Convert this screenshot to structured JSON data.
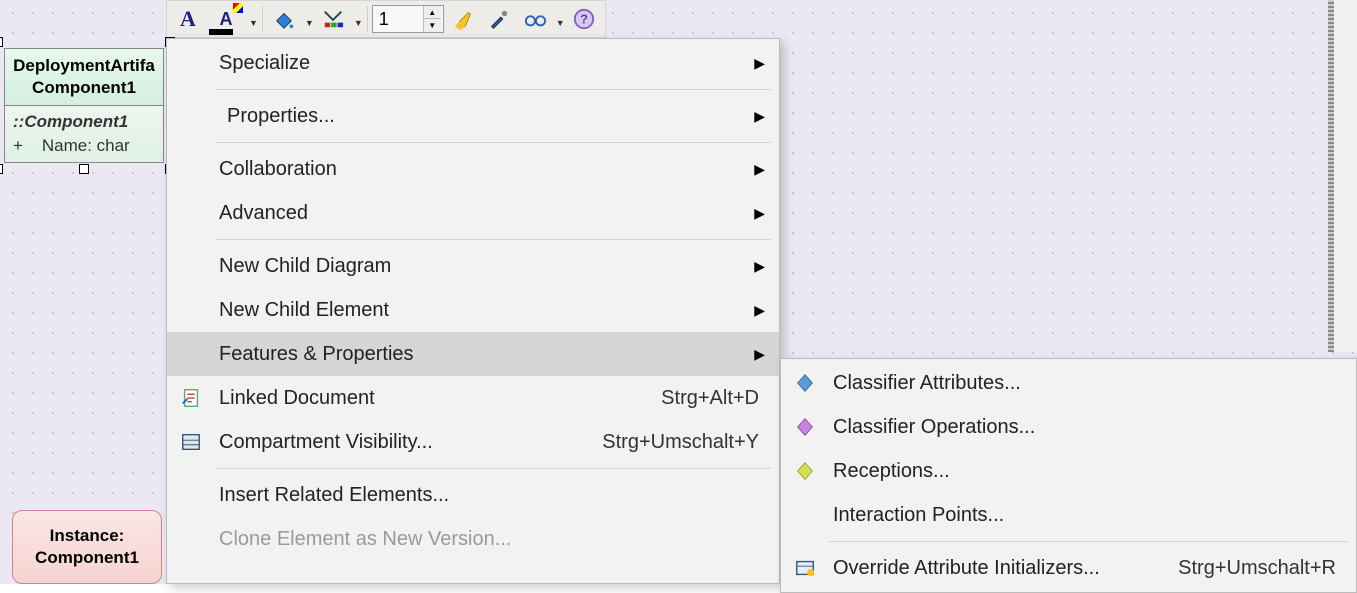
{
  "toolbar": {
    "spin_value": "1"
  },
  "component": {
    "title_line1": "DeploymentArtifa",
    "title_line2": "Component1",
    "section_name": "::Component1",
    "attr_prefix": "+",
    "attr_text": "Name: char"
  },
  "instance": {
    "line1": "Instance:",
    "line2": "Component1"
  },
  "menu": {
    "specialize": "Specialize",
    "properties": "Properties...",
    "collaboration": "Collaboration",
    "advanced": "Advanced",
    "new_child_diagram": "New Child Diagram",
    "new_child_element": "New Child Element",
    "features_properties": "Features & Properties",
    "linked_document": "Linked Document",
    "linked_document_sc": "Strg+Alt+D",
    "compartment_visibility": "Compartment Visibility...",
    "compartment_visibility_sc": "Strg+Umschalt+Y",
    "insert_related": "Insert Related Elements...",
    "clone_element": "Clone Element as New Version..."
  },
  "submenu": {
    "classifier_attributes": "Classifier Attributes...",
    "classifier_operations": "Classifier Operations...",
    "receptions": "Receptions...",
    "interaction_points": "Interaction Points...",
    "override_attr": "Override Attribute Initializers...",
    "override_attr_sc": "Strg+Umschalt+R"
  }
}
